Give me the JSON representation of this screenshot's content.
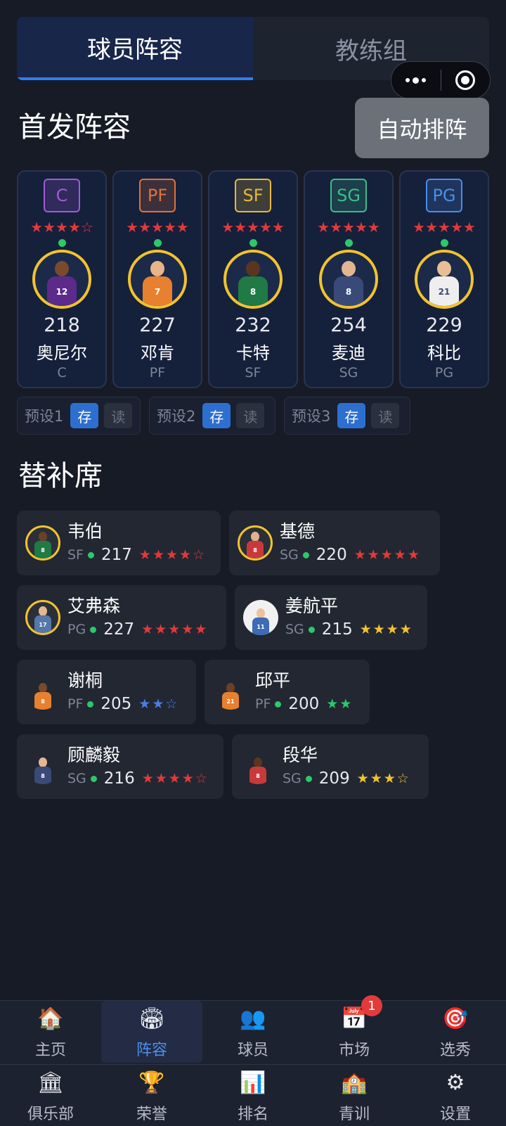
{
  "tabs": [
    {
      "label": "球员阵容",
      "active": true
    },
    {
      "label": "教练组",
      "active": false
    }
  ],
  "starting": {
    "title": "首发阵容",
    "auto_button": "自动排阵",
    "players": [
      {
        "badge": "C",
        "badge_color": "#a25ad8",
        "stars": "★★★★☆",
        "rating": "218",
        "name": "奥尼尔",
        "pos": "C",
        "jersey": "12",
        "jersey_color": "#5b2a8a",
        "skin": "#7a4a2e"
      },
      {
        "badge": "PF",
        "badge_color": "#e0733a",
        "stars": "★★★★★",
        "rating": "227",
        "name": "邓肯",
        "pos": "PF",
        "jersey": "7",
        "jersey_color": "#e7802f",
        "skin": "#e8b48a"
      },
      {
        "badge": "SF",
        "badge_color": "#e7b93a",
        "stars": "★★★★★",
        "rating": "232",
        "name": "卡特",
        "pos": "SF",
        "jersey": "8",
        "jersey_color": "#1f7a45",
        "skin": "#5a3620"
      },
      {
        "badge": "SG",
        "badge_color": "#3dbd8a",
        "stars": "★★★★★",
        "rating": "254",
        "name": "麦迪",
        "pos": "SG",
        "jersey": "8",
        "jersey_color": "#3a4a78",
        "skin": "#e2b690"
      },
      {
        "badge": "PG",
        "badge_color": "#4a8ee8",
        "stars": "★★★★★",
        "rating": "229",
        "name": "科比",
        "pos": "PG",
        "jersey": "21",
        "jersey_color": "#eeeeee",
        "skin": "#e9bd95"
      }
    ]
  },
  "presets": [
    {
      "label": "预设1",
      "save": "存",
      "load": "读"
    },
    {
      "label": "预设2",
      "save": "存",
      "load": "读"
    },
    {
      "label": "预设3",
      "save": "存",
      "load": "读"
    }
  ],
  "bench": {
    "title": "替补席",
    "players": [
      {
        "name": "韦伯",
        "pos": "SF",
        "rating": "217",
        "stars": "★★★★☆",
        "star_color": "#e03a3a",
        "frame": "gold",
        "jersey": "8",
        "jersey_color": "#1f7a45",
        "skin": "#6a4128"
      },
      {
        "name": "基德",
        "pos": "SG",
        "rating": "220",
        "stars": "★★★★★",
        "star_color": "#e03a3a",
        "frame": "gold",
        "jersey": "8",
        "jersey_color": "#c83a3a",
        "skin": "#e0b28c"
      },
      {
        "name": "艾弗森",
        "pos": "PG",
        "rating": "227",
        "stars": "★★★★★",
        "star_color": "#e03a3a",
        "frame": "gold",
        "jersey": "17",
        "jersey_color": "#5577aa",
        "skin": "#e5b890"
      },
      {
        "name": "姜航平",
        "pos": "SG",
        "rating": "215",
        "stars": "★★★★",
        "star_color": "#f2c330",
        "frame": "white",
        "jersey": "11",
        "jersey_color": "#3d6bb5",
        "skin": "#ecc39c"
      },
      {
        "name": "谢桐",
        "pos": "PF",
        "rating": "205",
        "stars": "★★☆",
        "star_color": "#4a7fe0",
        "frame": "none",
        "jersey": "8",
        "jersey_color": "#e7802f",
        "skin": "#7a4a2e"
      },
      {
        "name": "邱平",
        "pos": "PF",
        "rating": "200",
        "stars": "★★",
        "star_color": "#2cc86a",
        "frame": "none",
        "jersey": "21",
        "jersey_color": "#e7802f",
        "skin": "#6a4128"
      },
      {
        "name": "顾麟毅",
        "pos": "SG",
        "rating": "216",
        "stars": "★★★★☆",
        "star_color": "#e03a3a",
        "frame": "none",
        "jersey": "8",
        "jersey_color": "#3a4a78",
        "skin": "#e5b890"
      },
      {
        "name": "段华",
        "pos": "SG",
        "rating": "209",
        "stars": "★★★☆",
        "star_color": "#f2c330",
        "frame": "none",
        "jersey": "8",
        "jersey_color": "#c83a3a",
        "skin": "#5a3620"
      }
    ]
  },
  "nav": {
    "row1": [
      {
        "label": "主页",
        "icon": "house-icon",
        "glyph": "🏠",
        "active": false
      },
      {
        "label": "阵容",
        "icon": "stadium-icon",
        "glyph": "🏟",
        "active": true
      },
      {
        "label": "球员",
        "icon": "players-icon",
        "glyph": "👥",
        "active": false
      },
      {
        "label": "市场",
        "icon": "calendar-icon",
        "glyph": "📅",
        "active": false,
        "badge": "1"
      },
      {
        "label": "选秀",
        "icon": "target-icon",
        "glyph": "🎯",
        "active": false
      }
    ],
    "row2": [
      {
        "label": "俱乐部",
        "icon": "bank-icon",
        "glyph": "🏛",
        "active": false
      },
      {
        "label": "荣誉",
        "icon": "trophy-icon",
        "glyph": "🏆",
        "active": false
      },
      {
        "label": "排名",
        "icon": "bar-chart-icon",
        "glyph": "📊",
        "active": false
      },
      {
        "label": "青训",
        "icon": "school-icon",
        "glyph": "🏫",
        "active": false
      },
      {
        "label": "设置",
        "icon": "gear-icon",
        "glyph": "⚙",
        "active": false
      }
    ]
  }
}
